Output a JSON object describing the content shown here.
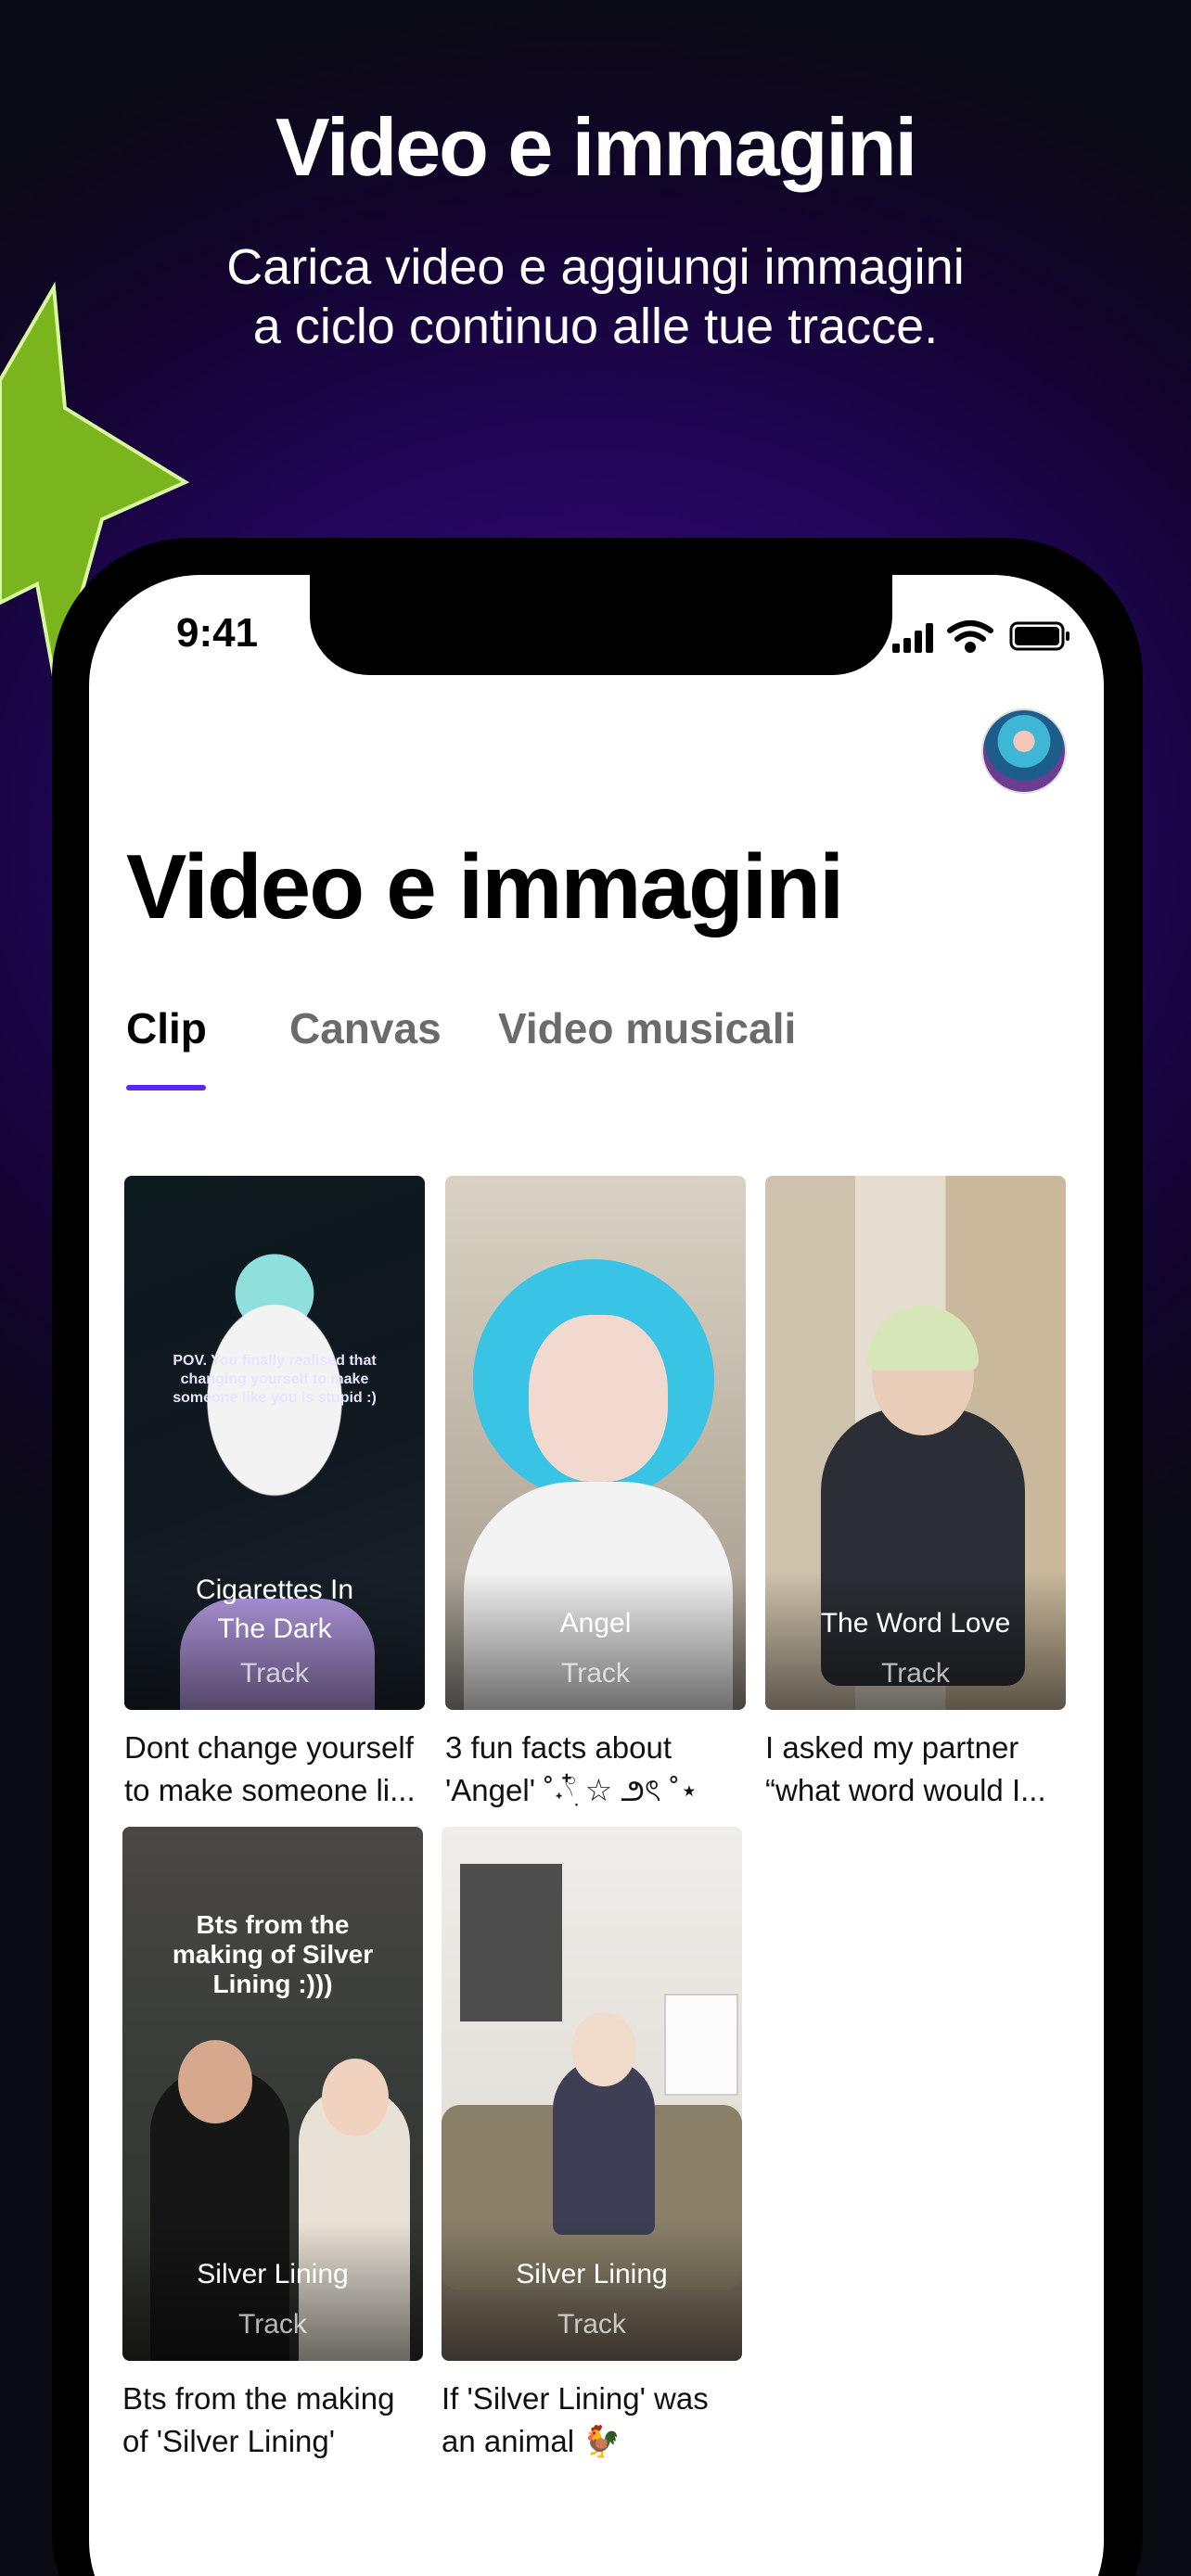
{
  "promo": {
    "headline": "Video e immagini",
    "subline_1": "Carica video e aggiungi immagini",
    "subline_2": "a ciclo continuo alle tue tracce."
  },
  "status_bar": {
    "time": "9:41"
  },
  "page": {
    "title": "Video e immagini"
  },
  "tabs": [
    {
      "label": "Clip",
      "active": true
    },
    {
      "label": "Canvas",
      "active": false
    },
    {
      "label": "Video musicali",
      "active": false
    }
  ],
  "clips": [
    {
      "track_title_1": "Cigarettes In",
      "track_title_2": "The Dark",
      "track_type": "Track",
      "overlay": "POV. You finally realised that changing yourself to make someone like you is stupid :)",
      "caption_1": "Dont change yourself",
      "caption_2": "to make someone li..."
    },
    {
      "track_title_1": "Angel",
      "track_title_2": "",
      "track_type": "Track",
      "overlay": "",
      "caption_1": "3 fun facts about",
      "caption_2": "'Angel' ˚˖𓍢ִ໋ ☆ ౨ৎ ˚⋆"
    },
    {
      "track_title_1": "The Word Love",
      "track_title_2": "",
      "track_type": "Track",
      "overlay": "",
      "caption_1": "I asked my partner",
      "caption_2": "“what word would I..."
    },
    {
      "track_title_1": "Silver Lining",
      "track_title_2": "",
      "track_type": "Track",
      "overlay": "Bts from the making of Silver Lining :)))",
      "caption_1": "Bts from the making",
      "caption_2": "of 'Silver Lining'"
    },
    {
      "track_title_1": "Silver Lining",
      "track_title_2": "",
      "track_type": "Track",
      "overlay": "",
      "caption_1": "If 'Silver Lining' was",
      "caption_2": "an animal 🐓"
    }
  ],
  "colors": {
    "accent": "#5b26f0",
    "blob": "#7ab51d"
  }
}
